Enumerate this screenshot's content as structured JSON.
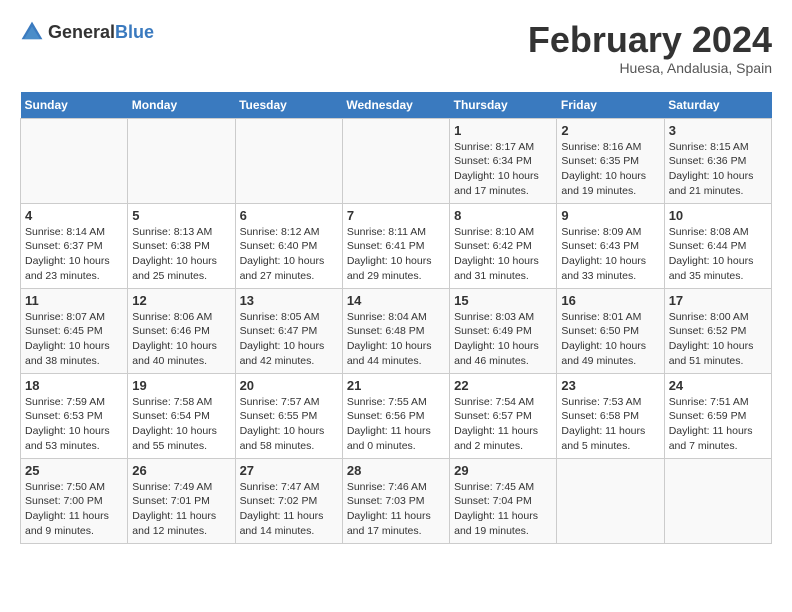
{
  "header": {
    "logo_general": "General",
    "logo_blue": "Blue",
    "month_year": "February 2024",
    "location": "Huesa, Andalusia, Spain"
  },
  "calendar": {
    "weekdays": [
      "Sunday",
      "Monday",
      "Tuesday",
      "Wednesday",
      "Thursday",
      "Friday",
      "Saturday"
    ],
    "weeks": [
      [
        {
          "day": "",
          "info": ""
        },
        {
          "day": "",
          "info": ""
        },
        {
          "day": "",
          "info": ""
        },
        {
          "day": "",
          "info": ""
        },
        {
          "day": "1",
          "info": "Sunrise: 8:17 AM\nSunset: 6:34 PM\nDaylight: 10 hours\nand 17 minutes."
        },
        {
          "day": "2",
          "info": "Sunrise: 8:16 AM\nSunset: 6:35 PM\nDaylight: 10 hours\nand 19 minutes."
        },
        {
          "day": "3",
          "info": "Sunrise: 8:15 AM\nSunset: 6:36 PM\nDaylight: 10 hours\nand 21 minutes."
        }
      ],
      [
        {
          "day": "4",
          "info": "Sunrise: 8:14 AM\nSunset: 6:37 PM\nDaylight: 10 hours\nand 23 minutes."
        },
        {
          "day": "5",
          "info": "Sunrise: 8:13 AM\nSunset: 6:38 PM\nDaylight: 10 hours\nand 25 minutes."
        },
        {
          "day": "6",
          "info": "Sunrise: 8:12 AM\nSunset: 6:40 PM\nDaylight: 10 hours\nand 27 minutes."
        },
        {
          "day": "7",
          "info": "Sunrise: 8:11 AM\nSunset: 6:41 PM\nDaylight: 10 hours\nand 29 minutes."
        },
        {
          "day": "8",
          "info": "Sunrise: 8:10 AM\nSunset: 6:42 PM\nDaylight: 10 hours\nand 31 minutes."
        },
        {
          "day": "9",
          "info": "Sunrise: 8:09 AM\nSunset: 6:43 PM\nDaylight: 10 hours\nand 33 minutes."
        },
        {
          "day": "10",
          "info": "Sunrise: 8:08 AM\nSunset: 6:44 PM\nDaylight: 10 hours\nand 35 minutes."
        }
      ],
      [
        {
          "day": "11",
          "info": "Sunrise: 8:07 AM\nSunset: 6:45 PM\nDaylight: 10 hours\nand 38 minutes."
        },
        {
          "day": "12",
          "info": "Sunrise: 8:06 AM\nSunset: 6:46 PM\nDaylight: 10 hours\nand 40 minutes."
        },
        {
          "day": "13",
          "info": "Sunrise: 8:05 AM\nSunset: 6:47 PM\nDaylight: 10 hours\nand 42 minutes."
        },
        {
          "day": "14",
          "info": "Sunrise: 8:04 AM\nSunset: 6:48 PM\nDaylight: 10 hours\nand 44 minutes."
        },
        {
          "day": "15",
          "info": "Sunrise: 8:03 AM\nSunset: 6:49 PM\nDaylight: 10 hours\nand 46 minutes."
        },
        {
          "day": "16",
          "info": "Sunrise: 8:01 AM\nSunset: 6:50 PM\nDaylight: 10 hours\nand 49 minutes."
        },
        {
          "day": "17",
          "info": "Sunrise: 8:00 AM\nSunset: 6:52 PM\nDaylight: 10 hours\nand 51 minutes."
        }
      ],
      [
        {
          "day": "18",
          "info": "Sunrise: 7:59 AM\nSunset: 6:53 PM\nDaylight: 10 hours\nand 53 minutes."
        },
        {
          "day": "19",
          "info": "Sunrise: 7:58 AM\nSunset: 6:54 PM\nDaylight: 10 hours\nand 55 minutes."
        },
        {
          "day": "20",
          "info": "Sunrise: 7:57 AM\nSunset: 6:55 PM\nDaylight: 10 hours\nand 58 minutes."
        },
        {
          "day": "21",
          "info": "Sunrise: 7:55 AM\nSunset: 6:56 PM\nDaylight: 11 hours\nand 0 minutes."
        },
        {
          "day": "22",
          "info": "Sunrise: 7:54 AM\nSunset: 6:57 PM\nDaylight: 11 hours\nand 2 minutes."
        },
        {
          "day": "23",
          "info": "Sunrise: 7:53 AM\nSunset: 6:58 PM\nDaylight: 11 hours\nand 5 minutes."
        },
        {
          "day": "24",
          "info": "Sunrise: 7:51 AM\nSunset: 6:59 PM\nDaylight: 11 hours\nand 7 minutes."
        }
      ],
      [
        {
          "day": "25",
          "info": "Sunrise: 7:50 AM\nSunset: 7:00 PM\nDaylight: 11 hours\nand 9 minutes."
        },
        {
          "day": "26",
          "info": "Sunrise: 7:49 AM\nSunset: 7:01 PM\nDaylight: 11 hours\nand 12 minutes."
        },
        {
          "day": "27",
          "info": "Sunrise: 7:47 AM\nSunset: 7:02 PM\nDaylight: 11 hours\nand 14 minutes."
        },
        {
          "day": "28",
          "info": "Sunrise: 7:46 AM\nSunset: 7:03 PM\nDaylight: 11 hours\nand 17 minutes."
        },
        {
          "day": "29",
          "info": "Sunrise: 7:45 AM\nSunset: 7:04 PM\nDaylight: 11 hours\nand 19 minutes."
        },
        {
          "day": "",
          "info": ""
        },
        {
          "day": "",
          "info": ""
        }
      ]
    ]
  }
}
